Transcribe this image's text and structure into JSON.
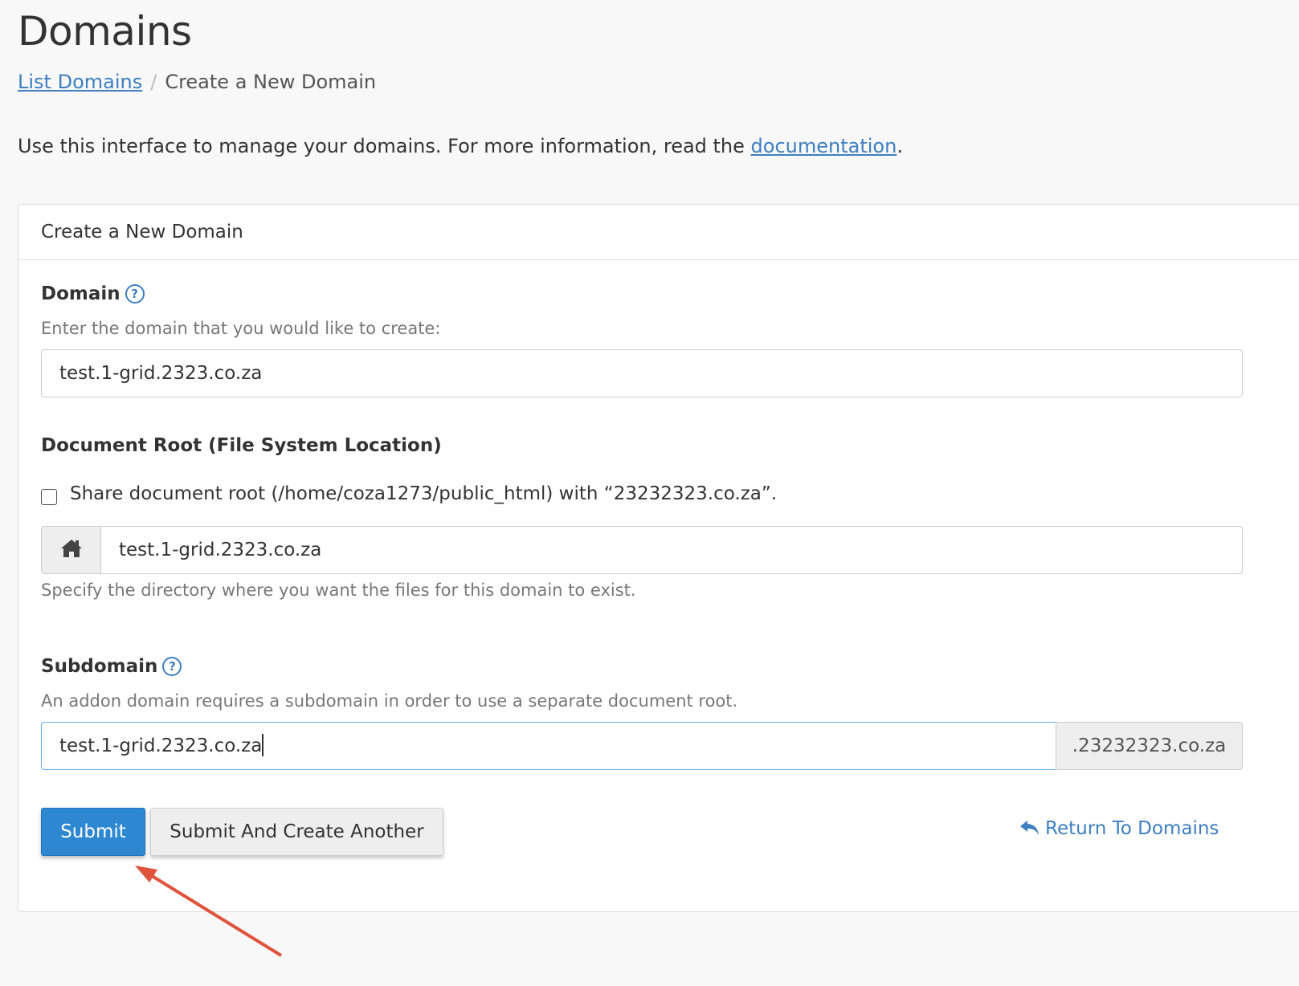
{
  "page": {
    "title": "Domains"
  },
  "breadcrumb": {
    "link": "List Domains",
    "separator": "/",
    "current": "Create a New Domain"
  },
  "intro": {
    "text": "Use this interface to manage your domains. For more information, read the ",
    "link": "documentation",
    "suffix": "."
  },
  "panel": {
    "heading": "Create a New Domain"
  },
  "domain": {
    "label": "Domain",
    "hint": "Enter the domain that you would like to create:",
    "value": "test.1-grid.2323.co.za"
  },
  "docroot": {
    "label": "Document Root (File System Location)",
    "share_label": "Share document root (/home/coza1273/public_html) with “23232323.co.za”.",
    "share_checked": false,
    "value": "test.1-grid.2323.co.za",
    "hint": "Specify the directory where you want the files for this domain to exist."
  },
  "subdomain": {
    "label": "Subdomain",
    "hint": "An addon domain requires a subdomain in order to use a separate document root.",
    "value": "test.1-grid.2323.co.za",
    "suffix": ".23232323.co.za"
  },
  "actions": {
    "submit": "Submit",
    "submit_another": "Submit And Create Another",
    "return": "Return To Domains"
  },
  "icons": {
    "help": "question-circle-icon",
    "home": "home-icon",
    "return": "reply-arrow-icon"
  },
  "colors": {
    "link": "#3d7fc1",
    "primary": "#2e87d1",
    "annotation_arrow": "#e0533c"
  }
}
